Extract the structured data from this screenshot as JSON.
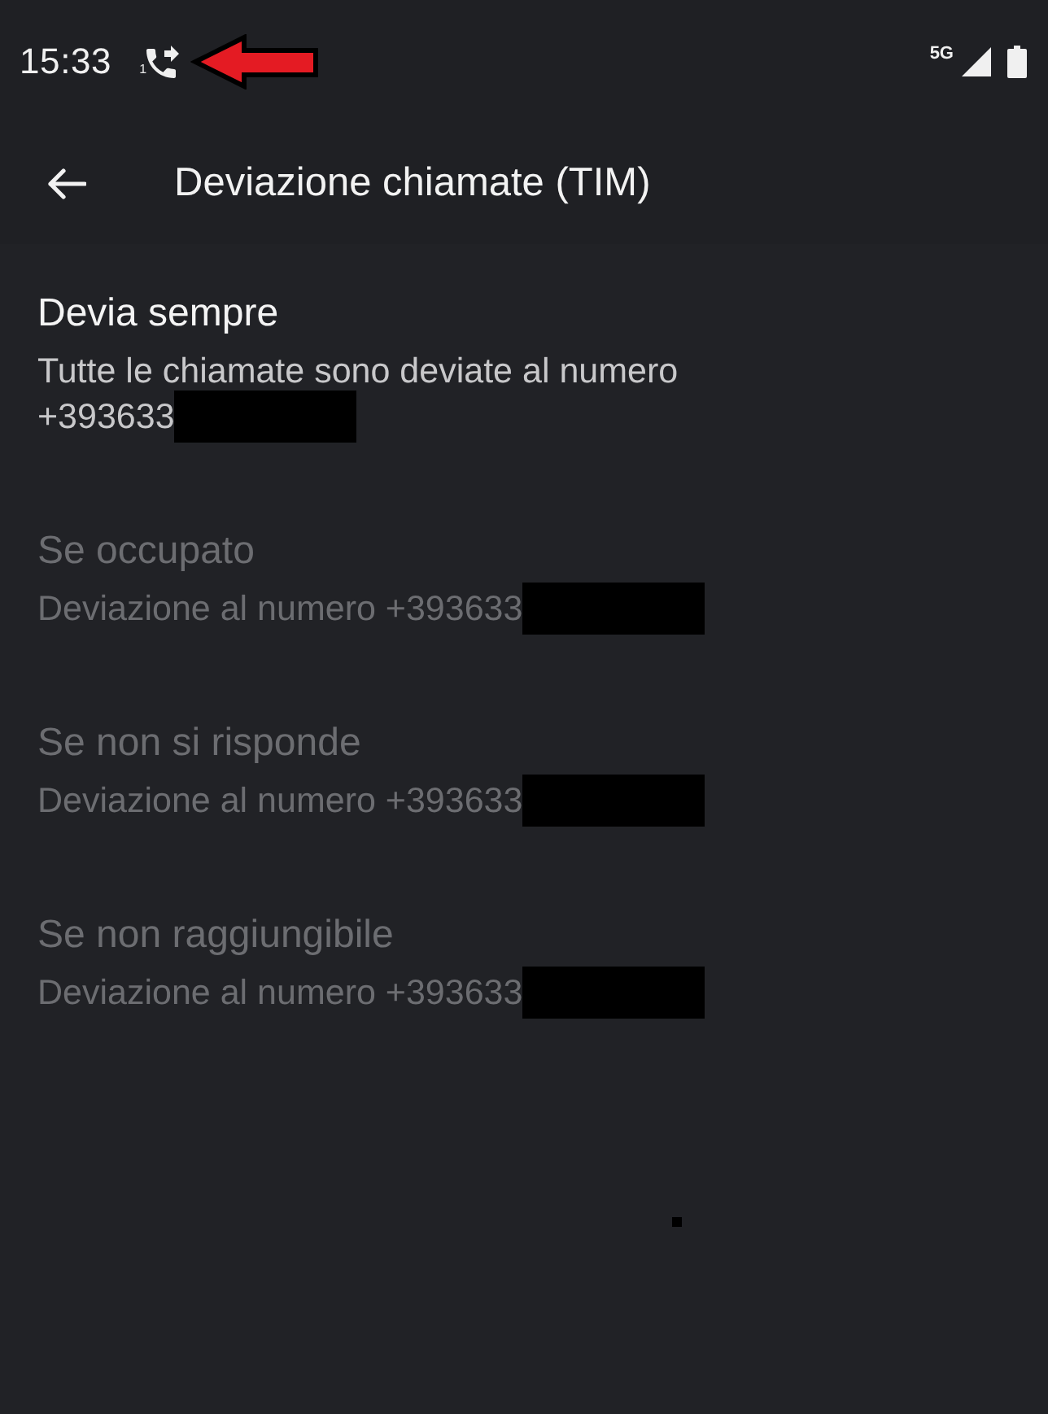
{
  "status_bar": {
    "time": "15:33",
    "sim_label": "1",
    "network": "5G"
  },
  "app_bar": {
    "title": "Deviazione chiamate (TIM)"
  },
  "items": [
    {
      "title": "Devia sempre",
      "subtitle_lines": [
        "Tutte le chiamate sono deviate al numero",
        "+393633"
      ],
      "disabled": false
    },
    {
      "title": "Se occupato",
      "subtitle_lines": [
        "Deviazione al numero +393633"
      ],
      "disabled": true
    },
    {
      "title": "Se non si risponde",
      "subtitle_lines": [
        "Deviazione al numero +393633"
      ],
      "disabled": true
    },
    {
      "title": "Se non raggiungibile",
      "subtitle_lines": [
        "Deviazione al numero +393633"
      ],
      "disabled": true
    }
  ]
}
